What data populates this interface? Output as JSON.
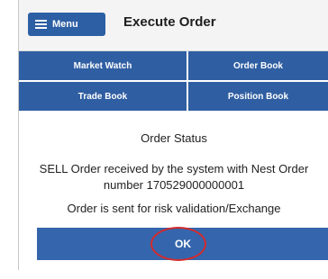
{
  "header": {
    "menu_label": "Menu",
    "title": "Execute Order"
  },
  "nav": {
    "tabs": [
      {
        "label": "Market Watch"
      },
      {
        "label": "Order Book"
      },
      {
        "label": "Trade Book"
      },
      {
        "label": "Position Book"
      }
    ]
  },
  "dialog": {
    "title": "Order Status",
    "message": "SELL Order received by the system with Nest Order number 170529000000001",
    "note": "Order is sent for risk validation/Exchange",
    "ok_label": "OK"
  },
  "colors": {
    "accent": "#2f5ea2",
    "highlight": "#d42a2a"
  },
  "icons": {
    "menu": "hamburger-icon"
  }
}
